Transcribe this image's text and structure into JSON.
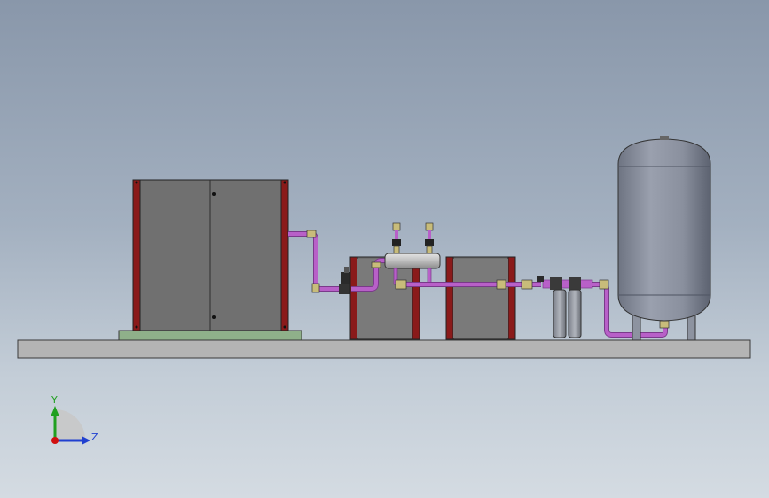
{
  "triad": {
    "y_label": "Y",
    "z_label": "Z",
    "y_color": "#20a020",
    "z_color": "#2040d0",
    "origin_color": "#d01010"
  },
  "colors": {
    "pipe": "#b860c8",
    "pipe_dark": "#7a3a8a",
    "fitting": "#c8bc7a",
    "cabinet_frame": "#8a1a1a",
    "cabinet_panel": "#707070",
    "base_plate": "#b4b4b4",
    "pad": "#8fb08a",
    "tank": "#9096a4",
    "filter": "#a0a4ae"
  },
  "components": [
    {
      "name": "compressor-unit"
    },
    {
      "name": "dryer-unit-1"
    },
    {
      "name": "dryer-unit-2"
    },
    {
      "name": "manifold-header"
    },
    {
      "name": "filter-assembly"
    },
    {
      "name": "air-receiver-tank"
    },
    {
      "name": "base-skid"
    }
  ]
}
